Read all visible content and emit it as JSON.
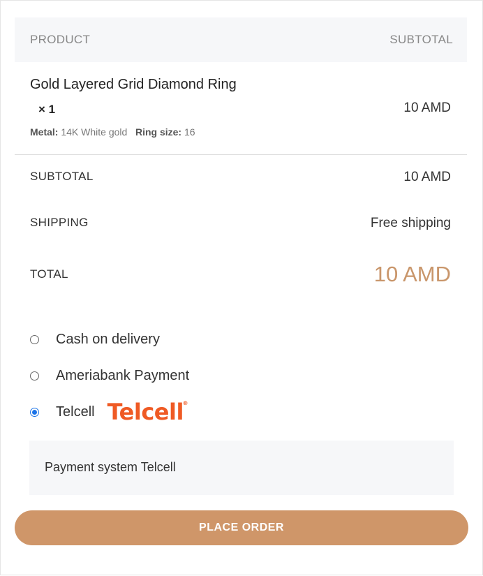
{
  "table_header": {
    "product": "PRODUCT",
    "subtotal": "SUBTOTAL"
  },
  "product": {
    "name": "Gold Layered Grid Diamond Ring",
    "quantity": "× 1",
    "metal_label": "Metal:",
    "metal_value": "14K White gold",
    "ring_size_label": "Ring size:",
    "ring_size_value": "16",
    "price": "10 AMD"
  },
  "summary": {
    "subtotal_label": "SUBTOTAL",
    "subtotal_value": "10 AMD",
    "shipping_label": "SHIPPING",
    "shipping_value": "Free shipping",
    "total_label": "TOTAL",
    "total_value": "10 AMD"
  },
  "payment": {
    "options": [
      {
        "label": "Cash on delivery",
        "selected": false
      },
      {
        "label": "Ameriabank Payment",
        "selected": false
      },
      {
        "label": "Telcell",
        "selected": true,
        "logo_text": "Telcell"
      }
    ],
    "selected_description": "Payment system Telcell"
  },
  "actions": {
    "place_order": "PLACE ORDER"
  },
  "colors": {
    "accent": "#cf9669",
    "total_text": "#c9966b",
    "telcell_brand": "#ef5a24",
    "radio_selected": "#1a73e8",
    "header_bg": "#f6f7f9"
  }
}
